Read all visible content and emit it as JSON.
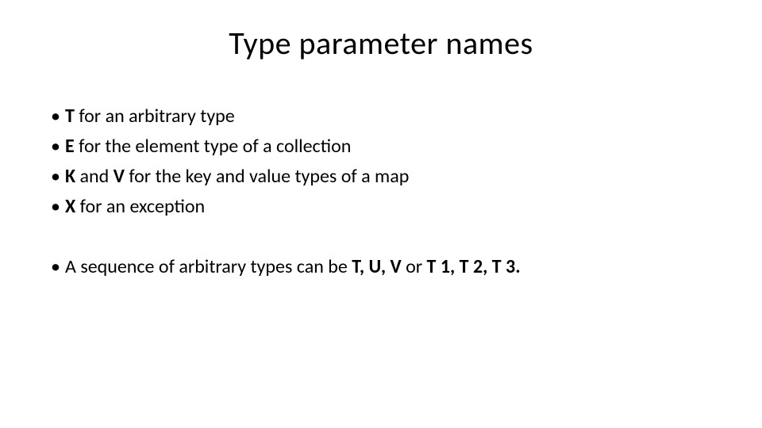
{
  "title": "Type parameter names",
  "b1": {
    "bold": "T",
    "rest": " for an arbitrary type"
  },
  "b2": {
    "bold": "E",
    "rest": " for the element type of a collection"
  },
  "b3": {
    "bold1": "K",
    "mid": " and ",
    "bold2": "V",
    "rest": " for the key and value types of a map"
  },
  "b4": {
    "bold": "X",
    "rest": " for an exception"
  },
  "b5": {
    "pre": "A sequence of arbitrary types can be ",
    "bold1": "T, U, V",
    "mid": " or ",
    "bold2": "T 1, T 2, T 3.",
    "rest": ""
  }
}
